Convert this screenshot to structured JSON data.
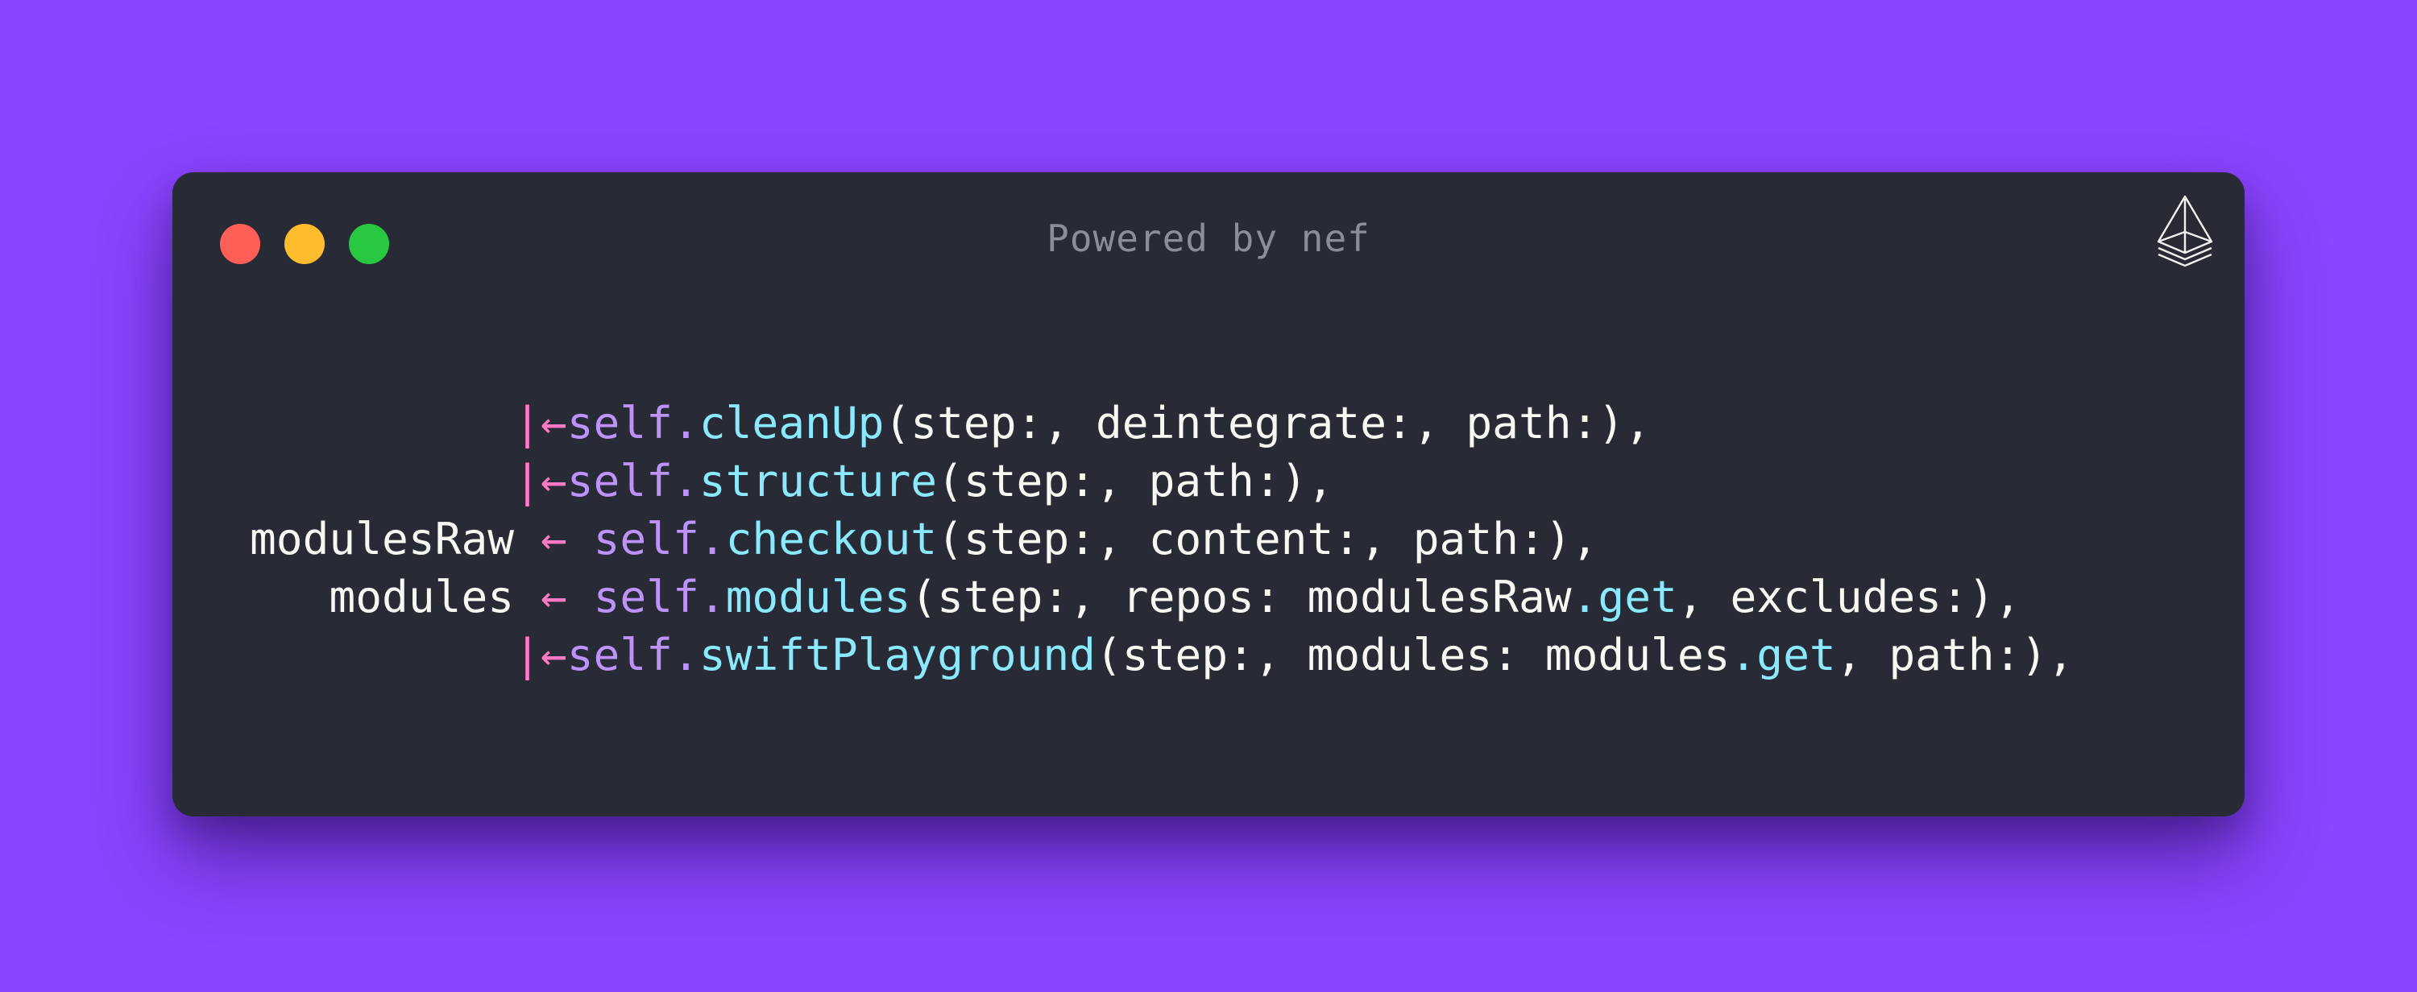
{
  "window": {
    "title": "Powered by nef",
    "logo_icon": "nef-logo-icon",
    "background_color": "#8b44ff",
    "window_color": "#282a36",
    "traffic_lights": {
      "close": "#ff5f57",
      "minimize": "#ffbd2e",
      "maximize": "#28c840"
    }
  },
  "code": {
    "colors": {
      "plain": "#f8f8f2",
      "arrow": "#ff79c6",
      "keyword": "#bd93f9",
      "function": "#8be9fd"
    },
    "lines": [
      [
        {
          "t": "plain",
          "v": "          "
        },
        {
          "t": "arrow",
          "v": "|←"
        },
        {
          "t": "self",
          "v": "self."
        },
        {
          "t": "fn",
          "v": "cleanUp"
        },
        {
          "t": "plain",
          "v": "(step:, deintegrate:, path:),"
        }
      ],
      [
        {
          "t": "plain",
          "v": "          "
        },
        {
          "t": "arrow",
          "v": "|←"
        },
        {
          "t": "self",
          "v": "self."
        },
        {
          "t": "fn",
          "v": "structure"
        },
        {
          "t": "plain",
          "v": "(step:, path:),"
        }
      ],
      [
        {
          "t": "plain",
          "v": "modulesRaw "
        },
        {
          "t": "arrow",
          "v": "←"
        },
        {
          "t": "plain",
          "v": " "
        },
        {
          "t": "self",
          "v": "self."
        },
        {
          "t": "fn",
          "v": "checkout"
        },
        {
          "t": "plain",
          "v": "(step:, content:, path:),"
        }
      ],
      [
        {
          "t": "plain",
          "v": "   modules "
        },
        {
          "t": "arrow",
          "v": "←"
        },
        {
          "t": "plain",
          "v": " "
        },
        {
          "t": "self",
          "v": "self."
        },
        {
          "t": "fn",
          "v": "modules"
        },
        {
          "t": "plain",
          "v": "(step:, repos: modulesRaw"
        },
        {
          "t": "fn",
          "v": ".get"
        },
        {
          "t": "plain",
          "v": ", excludes:),"
        }
      ],
      [
        {
          "t": "plain",
          "v": "          "
        },
        {
          "t": "arrow",
          "v": "|←"
        },
        {
          "t": "self",
          "v": "self."
        },
        {
          "t": "fn",
          "v": "swiftPlayground"
        },
        {
          "t": "plain",
          "v": "(step:, modules: modules"
        },
        {
          "t": "fn",
          "v": ".get"
        },
        {
          "t": "plain",
          "v": ", path:),"
        }
      ]
    ]
  }
}
